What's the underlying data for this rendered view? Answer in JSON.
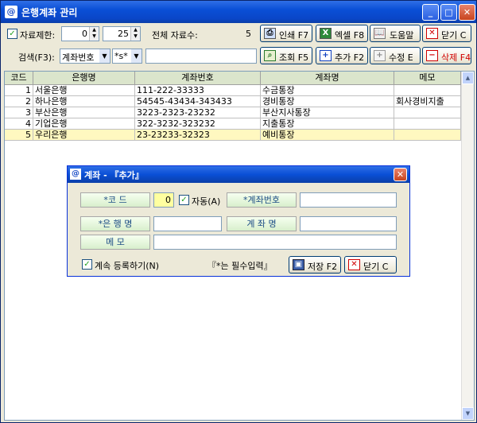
{
  "window": {
    "title": "은행계좌 관리",
    "icon": "@",
    "minimize": "_",
    "maximize": "□",
    "close": "✕"
  },
  "toolbar": {
    "limit_label": "자료제한:",
    "limit_from": "0",
    "limit_to": "25",
    "total_label": "전체 자료수:",
    "total_value": "5",
    "print_label": "인쇄 F7",
    "excel_label": "엑셀 F8",
    "help_label": "도움말",
    "close_label": "닫기 C"
  },
  "search": {
    "label": "검색(F3):",
    "field_value": "계좌번호",
    "mode_value": "*s*",
    "query_value": "",
    "find_label": "조회 F5",
    "add_label": "추가 F2",
    "edit_label": "수정 E",
    "delete_label": "삭제 F4"
  },
  "grid": {
    "columns": [
      "코드",
      "은행명",
      "계좌번호",
      "계좌명",
      "메모"
    ],
    "rows": [
      {
        "code": "1",
        "bank": "서울은행",
        "account": "111-222-33333",
        "name": "수금통장",
        "memo": ""
      },
      {
        "code": "2",
        "bank": "하나은행",
        "account": "54545-43434-343433",
        "name": "경비통장",
        "memo": "회사경비지출"
      },
      {
        "code": "3",
        "bank": "부산은행",
        "account": "3223-2323-23232",
        "name": "부산지사통장",
        "memo": ""
      },
      {
        "code": "4",
        "bank": "기업은행",
        "account": "322-3232-323232",
        "name": "지출통장",
        "memo": ""
      },
      {
        "code": "5",
        "bank": "우리은행",
        "account": "23-23233-32323",
        "name": "예비통장",
        "memo": ""
      }
    ],
    "selected_row": 5
  },
  "dialog": {
    "title": "계좌 - 『추가』",
    "code_label": "*코   드",
    "code_value": "0",
    "auto_label": "자동(A)",
    "account_label": "*계좌번호",
    "account_value": "",
    "bank_label": "*은 행 명",
    "bank_value": "",
    "name_label": "계 좌 명",
    "name_value": "",
    "memo_label": "메   모",
    "memo_value": "",
    "continue_label": "계속 등록하기(N)",
    "required_note": "『*는 필수입력』",
    "save_label": "저장 F2",
    "close_label": "닫기 C"
  },
  "colors": {
    "title_blue": "#0a4fd6",
    "header_green": "#dbe5cc",
    "selected_row": "#fff8c0",
    "delete_red": "#d00000"
  }
}
